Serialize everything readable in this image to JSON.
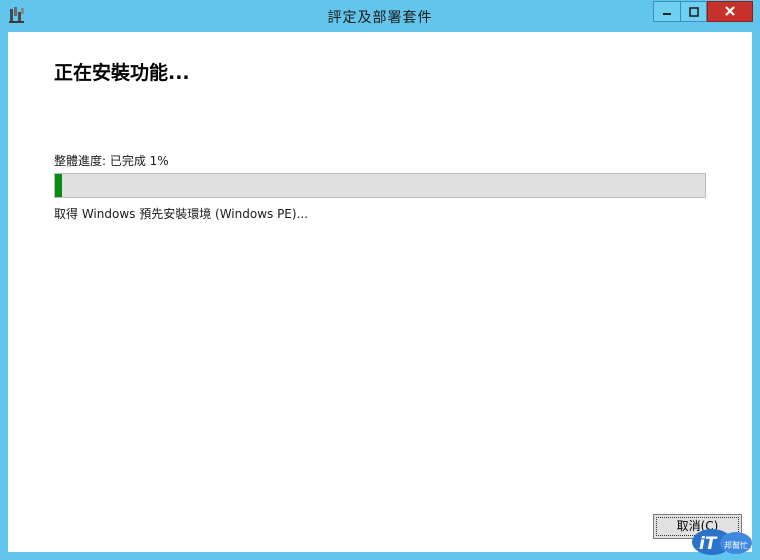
{
  "window": {
    "title": "評定及部署套件",
    "controls": {
      "minimize_icon": "minimize-icon",
      "maximize_icon": "maximize-icon",
      "close_icon": "close-icon"
    }
  },
  "main": {
    "heading": "正在安裝功能...",
    "progress_label": "整體進度: 已完成 1%",
    "progress_value": 0.01,
    "status_text": "取得 Windows 預先安裝環境 (Windows PE)..."
  },
  "footer": {
    "cancel_label": "取消(C)"
  },
  "watermark": {
    "text_it": "iT",
    "text_brand": "邦幫忙"
  },
  "colors": {
    "frame": "#62c6ec",
    "progress_fill": "#0a8a12",
    "close_button": "#c7312b"
  }
}
